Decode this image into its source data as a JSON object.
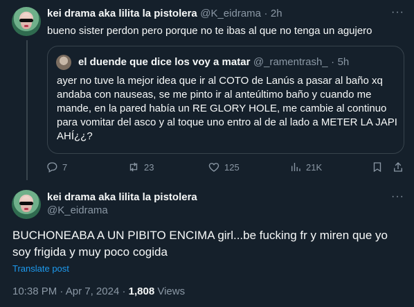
{
  "reply_tweet": {
    "display_name": "kei drama aka lilita la pistolera",
    "handle": "@K_eidrama",
    "separator": "·",
    "time": "2h",
    "text": "bueno sister perdon pero porque no te ibas al que no tenga un agujero",
    "more_icon": "more-horizontal-icon"
  },
  "quoted_tweet": {
    "display_name": "el duende que dice los voy a matar",
    "handle": "@_ramentrash_",
    "separator": "·",
    "time": "5h",
    "text": "ayer no tuve la mejor idea que ir al COTO de Lanús a pasar al baño xq andaba con nauseas, se me pinto ir al anteúltimo baño y cuando me mande, en la pared había un RE GLORY HOLE, me cambie al continuo para vomitar del asco y al toque uno entro al de al lado a METER LA JAPI AHÍ¿¿?"
  },
  "actions": {
    "replies": "7",
    "reposts": "23",
    "likes": "125",
    "views": "21K"
  },
  "main_tweet": {
    "display_name": "kei drama aka lilita la pistolera",
    "handle": "@K_eidrama",
    "text": "BUCHONEABA A UN PIBITO ENCIMA girl...be fucking fr y miren que yo soy frigida y muy poco cogida",
    "translate_label": "Translate post",
    "time": "10:38 PM",
    "date": "Apr 7, 2024",
    "separator": "·",
    "views_count": "1,808",
    "views_label": "Views"
  },
  "colors": {
    "background": "#15202b",
    "text": "#f7f9f9",
    "muted": "#8b98a5",
    "accent": "#1d9bf0",
    "border": "#38444d"
  }
}
